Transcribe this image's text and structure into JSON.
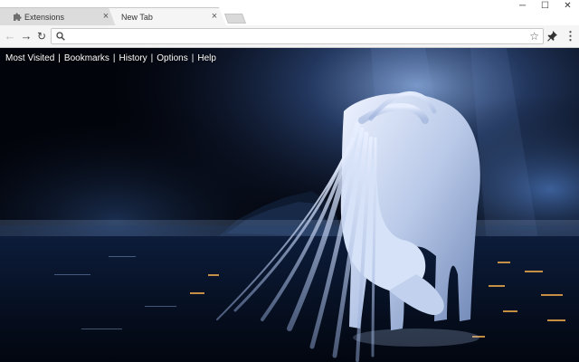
{
  "tabs": [
    {
      "title": "Extensions",
      "icon": "puzzle-icon",
      "active": false
    },
    {
      "title": "New Tab",
      "icon": "",
      "active": true
    }
  ],
  "window_controls": {
    "minimize": "─",
    "maximize": "☐",
    "close": "✕"
  },
  "toolbar": {
    "back": "←",
    "forward": "→",
    "reload": "↻",
    "omnibox_value": "",
    "bookmark_star": "☆",
    "menu": "⋮"
  },
  "links": {
    "most_visited": "Most Visited",
    "bookmarks": "Bookmarks",
    "history": "History",
    "options": "Options",
    "help": "Help",
    "separator": "|"
  },
  "colors": {
    "tabstrip_bg": "#ffffff",
    "active_tab_bg": "#f5f5f5",
    "inactive_tab_bg": "#dcdcdc",
    "link_text": "#ffffff",
    "background_dark": "#02040b",
    "glow_blue": "#5a86c8"
  },
  "background_image": {
    "subject": "glowing white horse drinking from water at night",
    "icon": "wallpaper-image"
  }
}
